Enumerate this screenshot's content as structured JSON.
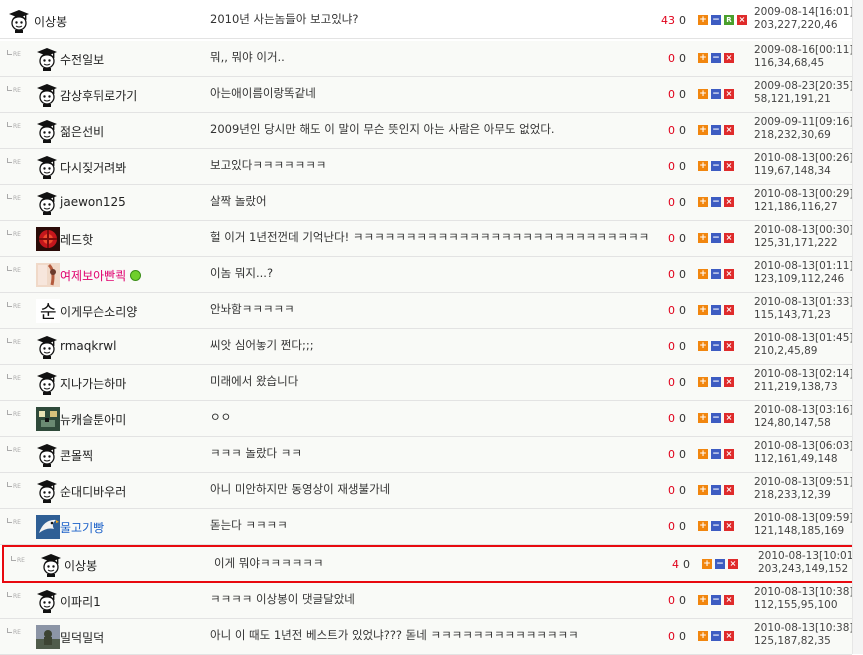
{
  "reply_marker": "RE",
  "comments": [
    {
      "nick": "이상봉",
      "text": "2010년 사는놈들아 보고있냐?",
      "up": "43",
      "down": "0",
      "date": "2009-08-14[16:01]",
      "ip": "203,227,220,46",
      "avatar": "grad",
      "nick_color": "",
      "is_reply": false,
      "show_reply_btn": true,
      "online": false,
      "highlight": false
    },
    {
      "nick": "수전일보",
      "text": "뭐,, 뭐야 이거..",
      "up": "0",
      "down": "0",
      "date": "2009-08-16[00:11]",
      "ip": "116,34,68,45",
      "avatar": "grad",
      "nick_color": "",
      "is_reply": true,
      "show_reply_btn": false,
      "online": false,
      "highlight": false
    },
    {
      "nick": "감상후뒤로가기",
      "text": "아는애이름이랑똑같네",
      "up": "0",
      "down": "0",
      "date": "2009-08-23[20:35]",
      "ip": "58,121,191,21",
      "avatar": "grad",
      "nick_color": "",
      "is_reply": true,
      "show_reply_btn": false,
      "online": false,
      "highlight": false
    },
    {
      "nick": "젊은선비",
      "text": "2009년인 당시만 해도 이 말이 무슨 뜻인지 아는 사람은 아무도 없었다.",
      "up": "0",
      "down": "0",
      "date": "2009-09-11[09:16]",
      "ip": "218,232,30,69",
      "avatar": "grad",
      "nick_color": "",
      "is_reply": true,
      "show_reply_btn": false,
      "online": false,
      "highlight": false
    },
    {
      "nick": "다시짖거려봐",
      "text": "보고있다ㅋㅋㅋㅋㅋㅋㅋ",
      "up": "0",
      "down": "0",
      "date": "2010-08-13[00:26]",
      "ip": "119,67,148,34",
      "avatar": "grad",
      "nick_color": "",
      "is_reply": true,
      "show_reply_btn": false,
      "online": false,
      "highlight": false
    },
    {
      "nick": "jaewon125",
      "text": "살짝 놀랐어",
      "up": "0",
      "down": "0",
      "date": "2010-08-13[00:29]",
      "ip": "121,186,116,27",
      "avatar": "grad",
      "nick_color": "",
      "is_reply": true,
      "show_reply_btn": false,
      "online": false,
      "highlight": false
    },
    {
      "nick": "레드핫",
      "text": "헐 이거 1년전껀데 기억난다! ㅋㅋㅋㅋㅋㅋㅋㅋㅋㅋㅋㅋㅋㅋㅋㅋㅋㅋㅋㅋㅋㅋㅋㅋㅋㅋㅋㅋ",
      "up": "0",
      "down": "0",
      "date": "2010-08-13[00:30]",
      "ip": "125,31,171,222",
      "avatar": "red",
      "nick_color": "",
      "is_reply": true,
      "show_reply_btn": false,
      "online": false,
      "highlight": false
    },
    {
      "nick": "여제보아빤쾩",
      "text": "이놈 뭐지...?",
      "up": "0",
      "down": "0",
      "date": "2010-08-13[01:11]",
      "ip": "123,109,112,246",
      "avatar": "photo",
      "nick_color": "pink",
      "is_reply": true,
      "show_reply_btn": false,
      "online": true,
      "highlight": false
    },
    {
      "nick": "이게무슨소리양",
      "text": "안놔함ㅋㅋㅋㅋㅋ",
      "up": "0",
      "down": "0",
      "date": "2010-08-13[01:33]",
      "ip": "115,143,71,23",
      "avatar": "char",
      "nick_color": "",
      "is_reply": true,
      "show_reply_btn": false,
      "online": false,
      "highlight": false
    },
    {
      "nick": "rmaqkrwl",
      "text": "씨앗 심어놓기 쩐다;;;",
      "up": "0",
      "down": "0",
      "date": "2010-08-13[01:45]",
      "ip": "210,2,45,89",
      "avatar": "grad",
      "nick_color": "",
      "is_reply": true,
      "show_reply_btn": false,
      "online": false,
      "highlight": false
    },
    {
      "nick": "지나가는하마",
      "text": "미래에서 왔습니다",
      "up": "0",
      "down": "0",
      "date": "2010-08-13[02:14]",
      "ip": "211,219,138,73",
      "avatar": "grad",
      "nick_color": "",
      "is_reply": true,
      "show_reply_btn": false,
      "online": false,
      "highlight": false
    },
    {
      "nick": "뉴캐슬툰아미",
      "text": "ㅇㅇ",
      "up": "0",
      "down": "0",
      "date": "2010-08-13[03:16]",
      "ip": "124,80,147,58",
      "avatar": "pixel",
      "nick_color": "",
      "is_reply": true,
      "show_reply_btn": false,
      "online": false,
      "highlight": false
    },
    {
      "nick": "콘몰찍",
      "text": "ㅋㅋㅋ 놀랐다 ㅋㅋ",
      "up": "0",
      "down": "0",
      "date": "2010-08-13[06:03]",
      "ip": "112,161,49,148",
      "avatar": "grad",
      "nick_color": "",
      "is_reply": true,
      "show_reply_btn": false,
      "online": false,
      "highlight": false
    },
    {
      "nick": "순대디바우러",
      "text": "아니 미안하지만 동영상이 재생불가네",
      "up": "0",
      "down": "0",
      "date": "2010-08-13[09:51]",
      "ip": "218,233,12,39",
      "avatar": "grad",
      "nick_color": "",
      "is_reply": true,
      "show_reply_btn": false,
      "online": false,
      "highlight": false
    },
    {
      "nick": "물고기빵",
      "text": "돋는다 ㅋㅋㅋㅋ",
      "up": "0",
      "down": "0",
      "date": "2010-08-13[09:59]",
      "ip": "121,148,185,169",
      "avatar": "bird",
      "nick_color": "blue",
      "is_reply": true,
      "show_reply_btn": false,
      "online": false,
      "highlight": false
    },
    {
      "nick": "이상봉",
      "text": "이게 뭐야ㅋㅋㅋㅋㅋㅋ",
      "up": "4",
      "down": "0",
      "date": "2010-08-13[10:01]",
      "ip": "203,243,149,152",
      "avatar": "grad",
      "nick_color": "",
      "is_reply": true,
      "show_reply_btn": false,
      "online": false,
      "highlight": true
    },
    {
      "nick": "이파리1",
      "text": "ㅋㅋㅋㅋ 이상봉이 댓글달았네",
      "up": "0",
      "down": "0",
      "date": "2010-08-13[10:38]",
      "ip": "112,155,95,100",
      "avatar": "grad",
      "nick_color": "",
      "is_reply": true,
      "show_reply_btn": false,
      "online": false,
      "highlight": false
    },
    {
      "nick": "밀덕밀덕",
      "text": "아니 이 때도 1년전 베스트가 있었냐??? 돋네 ㅋㅋㅋㅋㅋㅋㅋㅋㅋㅋㅋㅋㅋㅋ",
      "up": "0",
      "down": "0",
      "date": "2010-08-13[10:38]",
      "ip": "125,187,82,35",
      "avatar": "soldier",
      "nick_color": "",
      "is_reply": true,
      "show_reply_btn": false,
      "online": false,
      "highlight": false
    }
  ],
  "buttons": {
    "plus": "+",
    "minus": "−",
    "reply": "R",
    "delete": "×"
  },
  "colors": {
    "up_vote": "#e0001a",
    "highlight_border": "#e8090f",
    "plus_btn": "#f1860f",
    "minus_btn": "#3d5cc2",
    "reply_btn": "#4aa02c",
    "delete_btn": "#df2b2b",
    "nick_pink": "#e0006e",
    "nick_blue": "#1c61c9"
  }
}
